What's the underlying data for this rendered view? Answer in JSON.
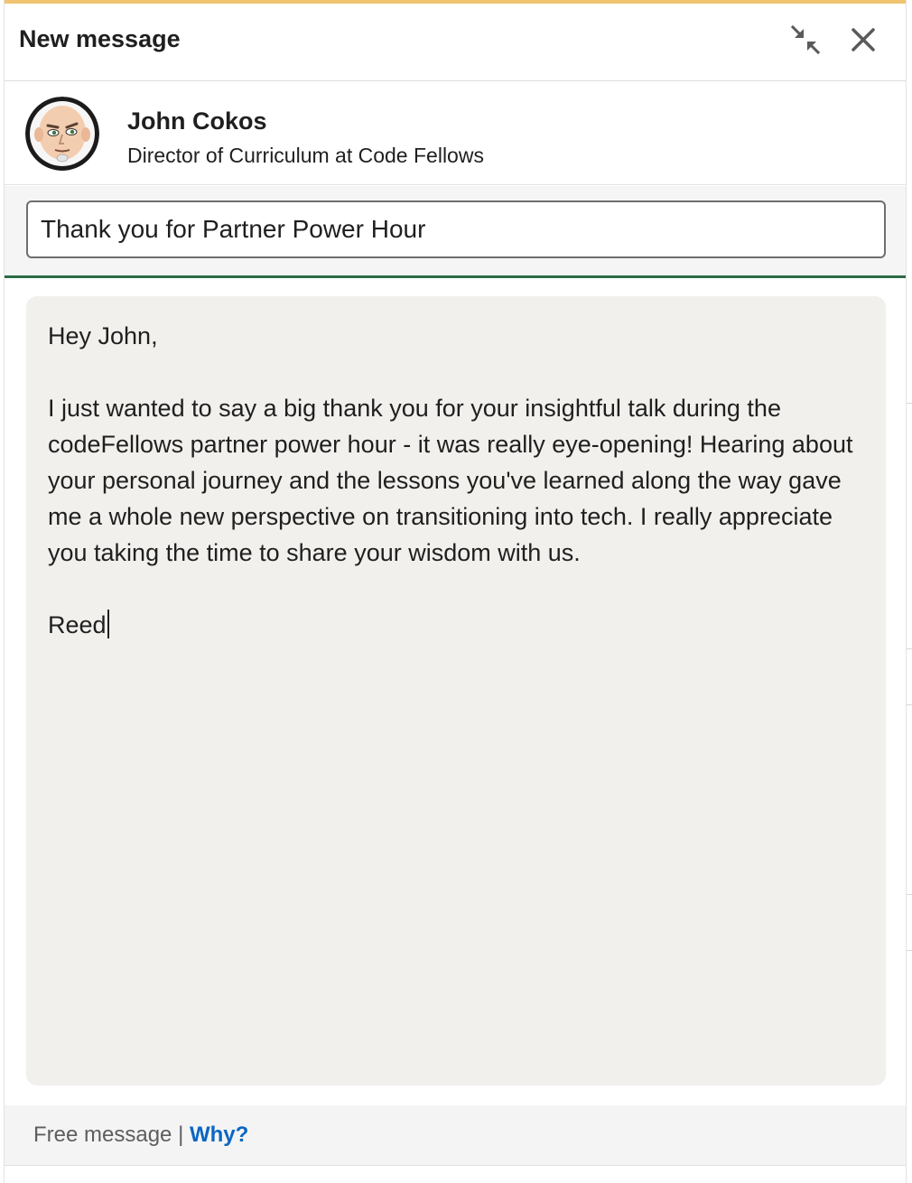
{
  "modal": {
    "title": "New message",
    "accent_color": "#f0c471"
  },
  "recipient": {
    "name": "John Cokos",
    "headline": "Director of Curriculum at Code Fellows",
    "avatar_icon": "avatar-icon"
  },
  "compose": {
    "subject_value": "Thank you for Partner Power Hour",
    "body": {
      "greeting": "Hey John,",
      "paragraph": "I just wanted to say a big thank you for your insightful talk during the codeFellows partner power hour - it was really eye-opening! Hearing about your personal journey and the lessons you've learned along the way gave me a whole new perspective on transitioning into tech. I really appreciate you taking the time to share your wisdom with us.",
      "signature": "Reed"
    }
  },
  "footer": {
    "text": "Free message | ",
    "link": "Why?",
    "link_color": "#0a66c2"
  },
  "icons": [
    "minimize-icon",
    "close-icon"
  ]
}
